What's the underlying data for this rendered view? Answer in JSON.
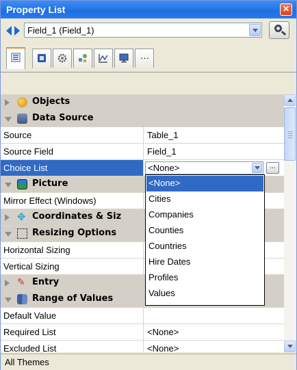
{
  "window": {
    "title": "Property List",
    "close_label": "✕"
  },
  "selector": {
    "value": "Field_1 (Field_1)"
  },
  "tabs": [
    {
      "icon": "all-properties-icon"
    },
    {
      "icon": "data-icon"
    },
    {
      "icon": "gear-icon"
    },
    {
      "icon": "objects-icon"
    },
    {
      "icon": "chart-icon"
    },
    {
      "icon": "display-icon"
    },
    {
      "icon": "more-icon",
      "label": "···"
    }
  ],
  "grid": {
    "cat_objects": "Objects",
    "cat_data_source": "Data Source",
    "source_name": "Source",
    "source_value": "Table_1",
    "source_field_name": "Source Field",
    "source_field_value": "Field_1",
    "choice_list_name": "Choice List",
    "choice_list_value": "<None>",
    "ellipsis": "...",
    "cat_picture": "Picture",
    "mirror_effect_name": "Mirror Effect (Windows)",
    "cat_coordinates": "Coordinates & Siz",
    "cat_resizing": "Resizing Options",
    "horizontal_sizing_name": "Horizontal Sizing",
    "vertical_sizing_name": "Vertical Sizing",
    "cat_entry": "Entry",
    "cat_range": "Range of Values",
    "default_value_name": "Default Value",
    "required_list_name": "Required List",
    "required_list_value": "<None>",
    "excluded_list_name": "Excluded List",
    "excluded_list_value": "<None>"
  },
  "dropdown": {
    "items": [
      "<None>",
      "Cities",
      "Companies",
      "Counties",
      "Countries",
      "Hire Dates",
      "Profiles",
      "Values"
    ]
  },
  "status": {
    "text": "All Themes"
  },
  "colors": {
    "selection": "#316ac5",
    "titlebar": "#1f6fe0",
    "category_bg": "#d4d0c8"
  }
}
